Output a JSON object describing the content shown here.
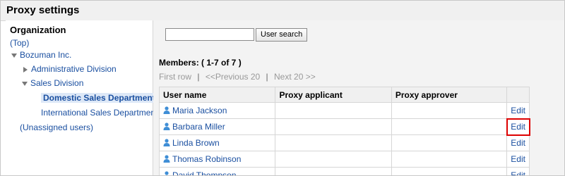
{
  "title": "Proxy settings",
  "organization": {
    "heading": "Organization",
    "top_link": "(Top)",
    "tree": [
      {
        "label": "Bozuman Inc.",
        "level": 0,
        "state": "expanded"
      },
      {
        "label": "Administrative Division",
        "level": 1,
        "state": "collapsed"
      },
      {
        "label": "Sales Division",
        "level": 1,
        "state": "expanded"
      },
      {
        "label": "Domestic Sales Department",
        "level": 2,
        "state": "selected"
      },
      {
        "label": "International Sales Department",
        "level": 2,
        "state": "leaf"
      }
    ],
    "unassigned": "(Unassigned users)"
  },
  "search": {
    "value": "",
    "button_label": "User search"
  },
  "members_text": "Members: ( 1-7 of 7 )",
  "pager": {
    "first": "First row",
    "sep": "|",
    "prev": "<<Previous 20",
    "next": "Next 20 >>"
  },
  "table": {
    "headers": [
      "User name",
      "Proxy applicant",
      "Proxy approver",
      ""
    ],
    "rows": [
      {
        "name": "Maria Jackson",
        "applicant": "",
        "approver": "",
        "action": "Edit"
      },
      {
        "name": "Barbara Miller",
        "applicant": "",
        "approver": "",
        "action": "Edit"
      },
      {
        "name": "Linda Brown",
        "applicant": "",
        "approver": "",
        "action": "Edit"
      },
      {
        "name": "Thomas Robinson",
        "applicant": "",
        "approver": "",
        "action": "Edit"
      },
      {
        "name": "David Thompson",
        "applicant": "",
        "approver": "",
        "action": "Edit"
      }
    ]
  },
  "colors": {
    "link": "#1a4fa0",
    "highlight": "#d00000",
    "selected_bg": "#dde8f7"
  }
}
